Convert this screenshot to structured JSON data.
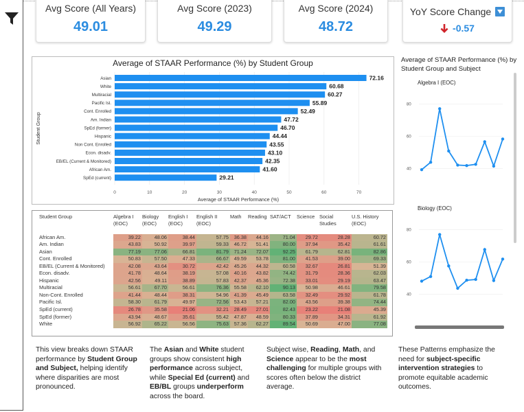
{
  "kpis": [
    {
      "title": "Avg Score (All Years)",
      "value": "49.01"
    },
    {
      "title": "Avg Score (2023)",
      "value": "49.29"
    },
    {
      "title": "Avg Score (2024)",
      "value": "48.72"
    }
  ],
  "yoy": {
    "title": "YoY Score Change",
    "value": "-0.57"
  },
  "colors": {
    "accent": "#2b8ce0",
    "bar": "#1e8ff0",
    "red": "#d0232a",
    "heat_low": "#e8817a",
    "heat_high": "#62b274"
  },
  "bar_chart": {
    "title": "Average of STAAR Performance (%) by Student Group",
    "xlabel": "Average of STAAR Performance (%)",
    "ylabel": "Student Group",
    "xticks": [
      "0",
      "10",
      "20",
      "30",
      "40",
      "50",
      "60",
      "70"
    ]
  },
  "chart_data": [
    {
      "type": "bar",
      "title": "Average of STAAR Performance (%) by Student Group",
      "xlabel": "Average of STAAR Performance (%)",
      "ylabel": "Student Group",
      "orientation": "horizontal",
      "xlim": [
        0,
        70
      ],
      "categories": [
        "Asian",
        "White",
        "Multiracial",
        "Pacific Isl.",
        "Cont. Enrolled",
        "Am. Indian",
        "SpEd (former)",
        "Hispanic",
        "Non Cont. Enrolled",
        "Econ. disadv.",
        "EB/EL (Current & Monitored)",
        "African Am.",
        "SpEd (current)"
      ],
      "values": [
        72.16,
        60.68,
        60.27,
        55.89,
        52.49,
        47.72,
        46.7,
        44.44,
        43.55,
        43.1,
        42.35,
        41.6,
        29.21
      ],
      "labels": [
        "72.16",
        "60.68",
        "60.27",
        "55.89",
        "52.49",
        "47.72",
        "46.70",
        "44.44",
        "43.55",
        "43.10",
        "42.35",
        "41.60",
        "29.21"
      ]
    },
    {
      "type": "line",
      "title": "Algebra I (EOC)",
      "ylim": [
        35,
        85
      ],
      "yticks": [
        "40",
        "60",
        "80"
      ],
      "values": [
        39.22,
        43.83,
        77.19,
        50.83,
        42.08,
        41.78,
        42.56,
        56.61,
        41.44,
        58.3
      ]
    },
    {
      "type": "line",
      "title": "Biology (EOC)",
      "ylim": [
        35,
        85
      ],
      "yticks": [
        "40",
        "60",
        "80"
      ],
      "values": [
        48.06,
        50.92,
        77.06,
        57.5,
        43.64,
        48.64,
        49.11,
        67.7,
        48.44,
        61.79
      ]
    }
  ],
  "matrix": {
    "headers": [
      "Student Group",
      "Algebra I\n(EOC)",
      "Biology\n(EOC)",
      "English I\n(EOC)",
      "English II\n(EOC)",
      "Math",
      "Reading",
      "SAT/ACT",
      "Science",
      "Social\nStudies",
      "U.S. History\n(EOC)"
    ],
    "rows": [
      {
        "group": "African Am.",
        "values": [
          "39.22",
          "48.06",
          "38.44",
          "57.75",
          "36.38",
          "44.16",
          "71.04",
          "29.72",
          "28.28",
          "60.72"
        ]
      },
      {
        "group": "Am. Indian",
        "values": [
          "43.83",
          "50.92",
          "39.97",
          "59.33",
          "46.72",
          "51.41",
          "80.00",
          "37.94",
          "35.42",
          "61.61"
        ]
      },
      {
        "group": "Asian",
        "values": [
          "77.19",
          "77.06",
          "66.81",
          "81.79",
          "71.24",
          "72.07",
          "92.25",
          "61.79",
          "62.81",
          "82.86"
        ]
      },
      {
        "group": "Cont. Enrolled",
        "values": [
          "50.83",
          "57.50",
          "47.33",
          "66.67",
          "49.59",
          "53.78",
          "81.00",
          "41.53",
          "39.00",
          "69.33"
        ]
      },
      {
        "group": "EB/EL (Current & Monitored)",
        "values": [
          "42.08",
          "43.64",
          "30.72",
          "42.42",
          "45.26",
          "44.32",
          "60.58",
          "32.67",
          "26.81",
          "51.39"
        ]
      },
      {
        "group": "Econ. disadv.",
        "values": [
          "41.78",
          "48.64",
          "38.19",
          "57.08",
          "40.16",
          "43.82",
          "74.42",
          "31.79",
          "28.36",
          "62.03"
        ]
      },
      {
        "group": "Hispanic",
        "values": [
          "42.56",
          "49.11",
          "38.89",
          "57.83",
          "42.37",
          "45.36",
          "72.38",
          "33.01",
          "29.19",
          "63.47"
        ]
      },
      {
        "group": "Multiracial",
        "values": [
          "56.61",
          "67.70",
          "56.61",
          "76.36",
          "55.58",
          "62.10",
          "90.13",
          "50.98",
          "46.61",
          "79.58"
        ]
      },
      {
        "group": "Non-Cont. Enrolled",
        "values": [
          "41.44",
          "48.44",
          "38.31",
          "54.96",
          "41.39",
          "45.49",
          "63.58",
          "32.49",
          "29.92",
          "61.78"
        ]
      },
      {
        "group": "Pacific Isl.",
        "values": [
          "58.30",
          "61.79",
          "49.97",
          "72.56",
          "53.43",
          "57.21",
          "82.00",
          "43.56",
          "39.38",
          "74.44"
        ]
      },
      {
        "group": "SpEd (current)",
        "values": [
          "26.78",
          "35.58",
          "21.06",
          "32.21",
          "28.49",
          "27.01",
          "82.43",
          "23.22",
          "21.08",
          "45.39"
        ]
      },
      {
        "group": "SpEd (former)",
        "values": [
          "43.94",
          "48.67",
          "35.61",
          "55.42",
          "47.87",
          "48.59",
          "80.33",
          "37.89",
          "34.31",
          "61.92"
        ]
      },
      {
        "group": "White",
        "values": [
          "56.92",
          "65.22",
          "56.56",
          "75.63",
          "57.36",
          "62.27",
          "89.54",
          "50.69",
          "47.00",
          "77.08"
        ]
      }
    ]
  },
  "right_panel": {
    "title": "Average of STAAR Performance (%) by Student Group and Subject",
    "subtitles": [
      "Algebra I (EOC)",
      "Biology (EOC)"
    ]
  },
  "text_blocks": [
    [
      {
        "t": "This view breaks down STAAR performance by "
      },
      {
        "t": "Student Group and Subject,",
        "b": true
      },
      {
        "t": " helping identify where disparities are most pronounced."
      }
    ],
    [
      {
        "t": "The "
      },
      {
        "t": "Asian",
        "b": true
      },
      {
        "t": " and "
      },
      {
        "t": "White",
        "b": true
      },
      {
        "t": " student groups show consistent "
      },
      {
        "t": "high performance",
        "b": true
      },
      {
        "t": " across subject, while "
      },
      {
        "t": "Special Ed (current)",
        "b": true
      },
      {
        "t": " and "
      },
      {
        "t": "EB/BL",
        "b": true
      },
      {
        "t": " groups "
      },
      {
        "t": "underperform",
        "b": true
      },
      {
        "t": " across the board."
      }
    ],
    [
      {
        "t": "Subject wise, "
      },
      {
        "t": "Reading",
        "b": true
      },
      {
        "t": ", "
      },
      {
        "t": "Math",
        "b": true
      },
      {
        "t": ", and "
      },
      {
        "t": "Science",
        "b": true
      },
      {
        "t": " appear to be the "
      },
      {
        "t": "most challenging",
        "b": true
      },
      {
        "t": " for multiple groups with scores often below the district average."
      }
    ],
    [
      {
        "t": "These Patterns emphasize the need for "
      },
      {
        "t": "subject-specific intervention strategies",
        "b": true
      },
      {
        "t": " to promote equitable academic outcomes."
      }
    ]
  ]
}
